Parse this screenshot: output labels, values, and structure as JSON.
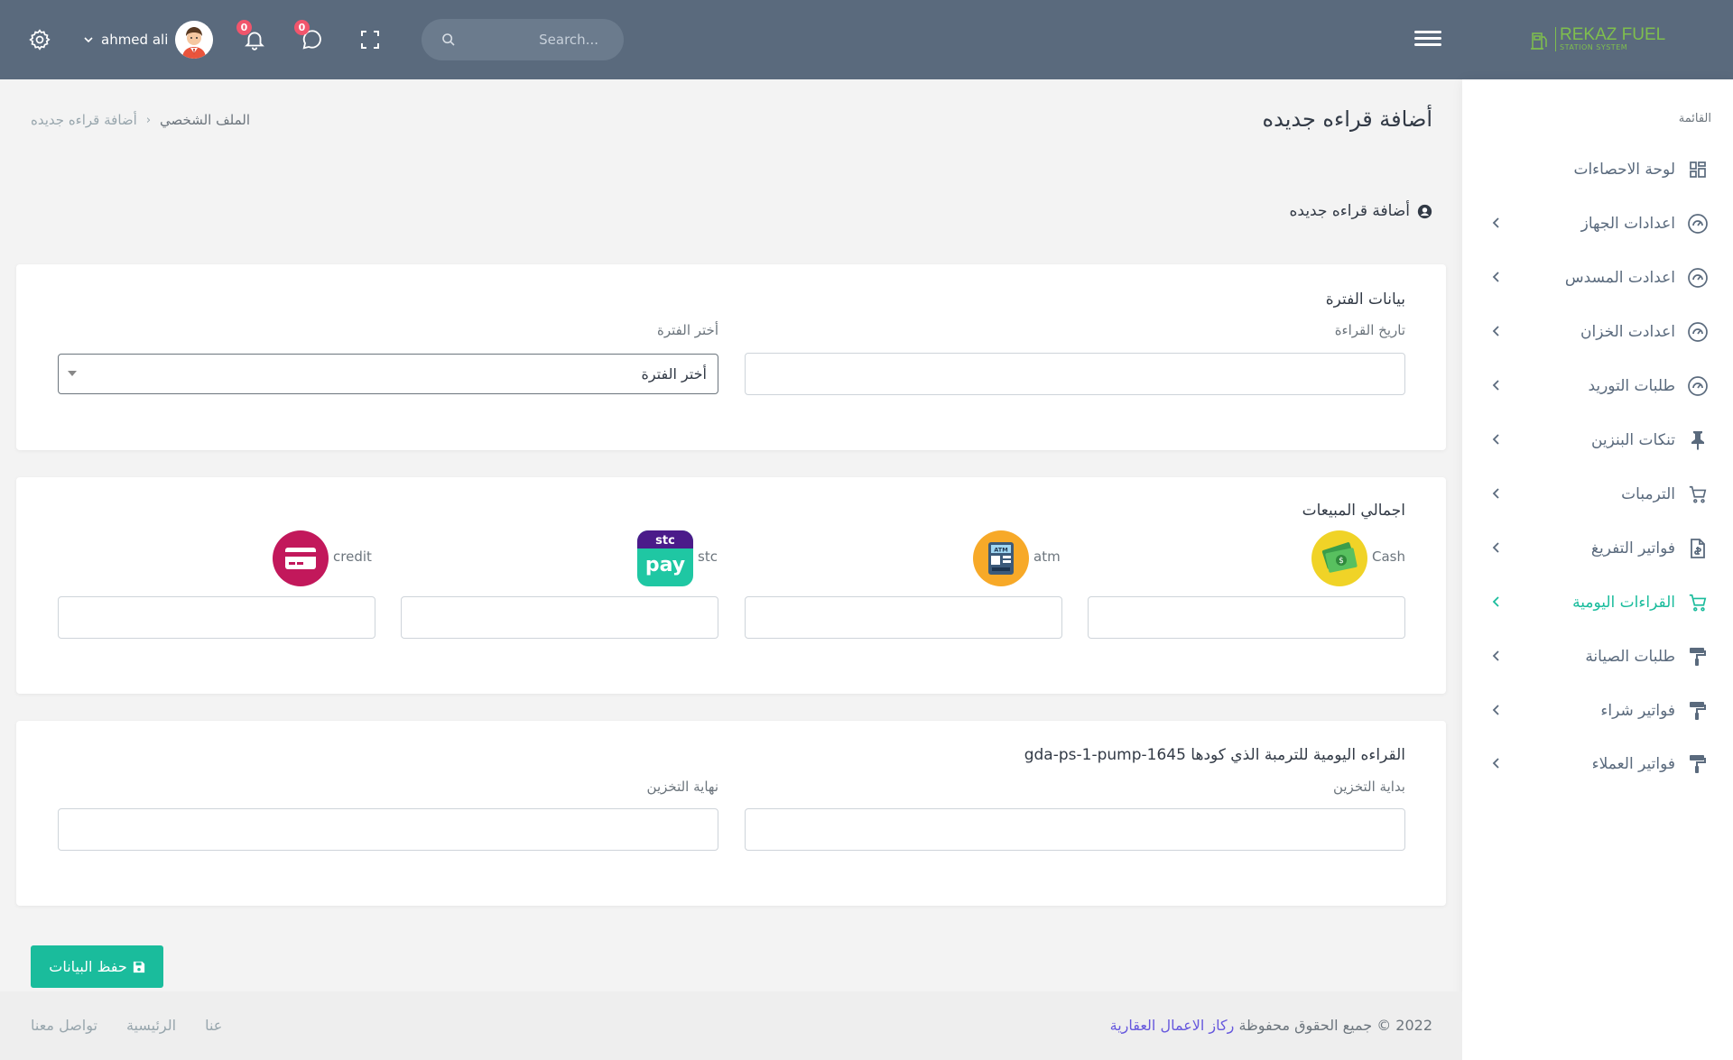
{
  "navbar": {
    "user_name": "ahmed ali",
    "notifications_count": "0",
    "messages_count": "0",
    "search_placeholder": "Search...",
    "logo_title": "REKAZ FUEL",
    "logo_subtitle": "STATION SYSTEM"
  },
  "sidebar": {
    "menu_title": "القائمة",
    "items": [
      {
        "label": "لوحة الاحصاءات",
        "icon": "dashboard-icon"
      },
      {
        "label": "اعدادات الجهاز",
        "icon": "gauge-icon"
      },
      {
        "label": "اعدادت المسدس",
        "icon": "gauge-icon"
      },
      {
        "label": "اعدادت الخزان",
        "icon": "gauge-icon"
      },
      {
        "label": "طلبات التوريد",
        "icon": "gauge-icon"
      },
      {
        "label": "تنكات البنزين",
        "icon": "pin-icon"
      },
      {
        "label": "الترمبات",
        "icon": "cart-icon"
      },
      {
        "label": "فواتير التفريغ",
        "icon": "invoice-icon"
      },
      {
        "label": "القراءات اليومية",
        "icon": "cart-icon",
        "active": true
      },
      {
        "label": "طلبات الصيانة",
        "icon": "paint-roller-icon"
      },
      {
        "label": "فواتير شراء",
        "icon": "paint-roller-icon"
      },
      {
        "label": "فواتير العملاء",
        "icon": "paint-roller-icon"
      }
    ]
  },
  "page": {
    "title": "أضافة قراءه جديده",
    "breadcrumb_parent": "الملف الشخصي",
    "breadcrumb_current": "أضافة قراءه جديده",
    "section_heading": "أضافة قراءه جديده"
  },
  "period_card": {
    "title": "بيانات الفترة",
    "date_label": "تاريخ القراءة",
    "date_value": "",
    "period_label": "أختر الفترة",
    "period_selected": "أختر الفترة"
  },
  "sales_card": {
    "title": "اجمالي المبيعات",
    "cash_label": "Cash",
    "atm_label": "atm",
    "stc_label": "stc",
    "credit_label": "credit",
    "atm_icon_text": "ATM",
    "stc_icon_top": "stc",
    "stc_icon_bottom": "pay"
  },
  "pump_card": {
    "title": "القراءه اليومية للترمبة الذي كودها gda-ps-1-pump-1645",
    "start_label": "بداية التخزين",
    "end_label": "نهاية التخزين"
  },
  "save_button": "حفظ البيانات",
  "footer": {
    "copyright": "2022 © جميع الحقوق محفوظة",
    "brand": "ركاز الاعمال العقارية",
    "links": [
      "عنا",
      "الرئيسية",
      "تواصل معنا"
    ]
  },
  "colors": {
    "navbar": "#5a6a7d",
    "accent": "#1abc9c",
    "badge": "#f1556c",
    "brand_link": "#6658dd",
    "logo": "#7fbf4d"
  }
}
